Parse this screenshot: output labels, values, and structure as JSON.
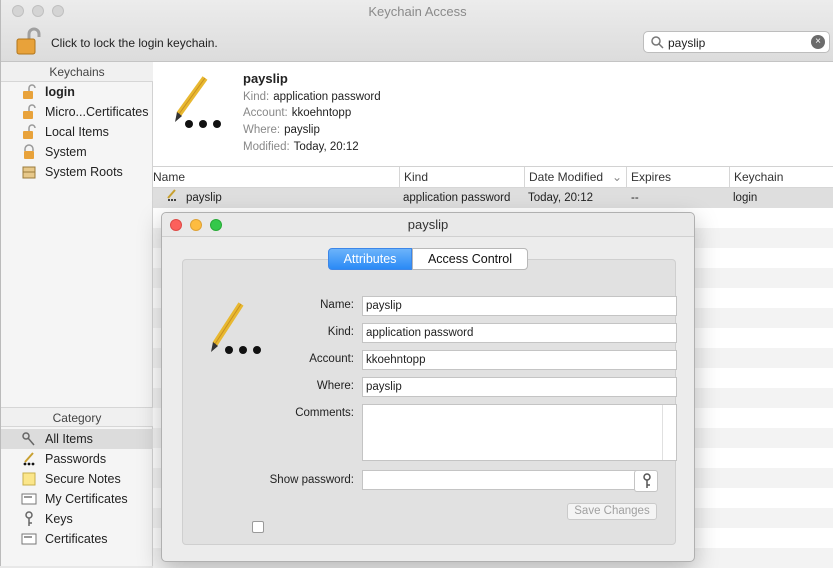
{
  "window": {
    "title": "Keychain Access"
  },
  "toolbar": {
    "lock_hint": "Click to lock the login keychain."
  },
  "search": {
    "value": "payslip"
  },
  "keychains": {
    "header": "Keychains",
    "items": [
      {
        "label": "login",
        "icon": "unlocked-padlock-icon"
      },
      {
        "label": "Micro...Certificates",
        "icon": "unlocked-padlock-icon"
      },
      {
        "label": "Local Items",
        "icon": "unlocked-padlock-icon"
      },
      {
        "label": "System",
        "icon": "locked-padlock-icon"
      },
      {
        "label": "System Roots",
        "icon": "cabinet-icon"
      }
    ]
  },
  "category": {
    "header": "Category",
    "items": [
      {
        "label": "All Items",
        "icon": "keys-icon"
      },
      {
        "label": "Passwords",
        "icon": "ellipsis-icon"
      },
      {
        "label": "Secure Notes",
        "icon": "note-icon"
      },
      {
        "label": "My Certificates",
        "icon": "certificate-icon"
      },
      {
        "label": "Keys",
        "icon": "key-icon"
      },
      {
        "label": "Certificates",
        "icon": "certificate-icon"
      }
    ]
  },
  "detail": {
    "name": "payslip",
    "kind_label": "Kind:",
    "kind": "application password",
    "account_label": "Account:",
    "account": "kkoehntopp",
    "where_label": "Where:",
    "where": "payslip",
    "modified_label": "Modified:",
    "modified": "Today, 20:12"
  },
  "table": {
    "columns": [
      "Name",
      "Kind",
      "Date Modified",
      "Expires",
      "Keychain"
    ],
    "rows": [
      {
        "name": "payslip",
        "kind": "application password",
        "date": "Today, 20:12",
        "expires": "--",
        "keychain": "login"
      }
    ]
  },
  "dialog": {
    "title": "payslip",
    "tabs": [
      "Attributes",
      "Access Control"
    ],
    "labels": {
      "name": "Name:",
      "kind": "Kind:",
      "account": "Account:",
      "where": "Where:",
      "comments": "Comments:",
      "show_password": "Show password:"
    },
    "values": {
      "name": "payslip",
      "kind": "application password",
      "account": "kkoehntopp",
      "where": "payslip",
      "comments": "",
      "password": ""
    },
    "save_label": "Save Changes"
  },
  "colors": {
    "accent": "#2a8af6",
    "close": "#fc605c",
    "minimize": "#fdbc40",
    "zoom": "#34c84a"
  }
}
